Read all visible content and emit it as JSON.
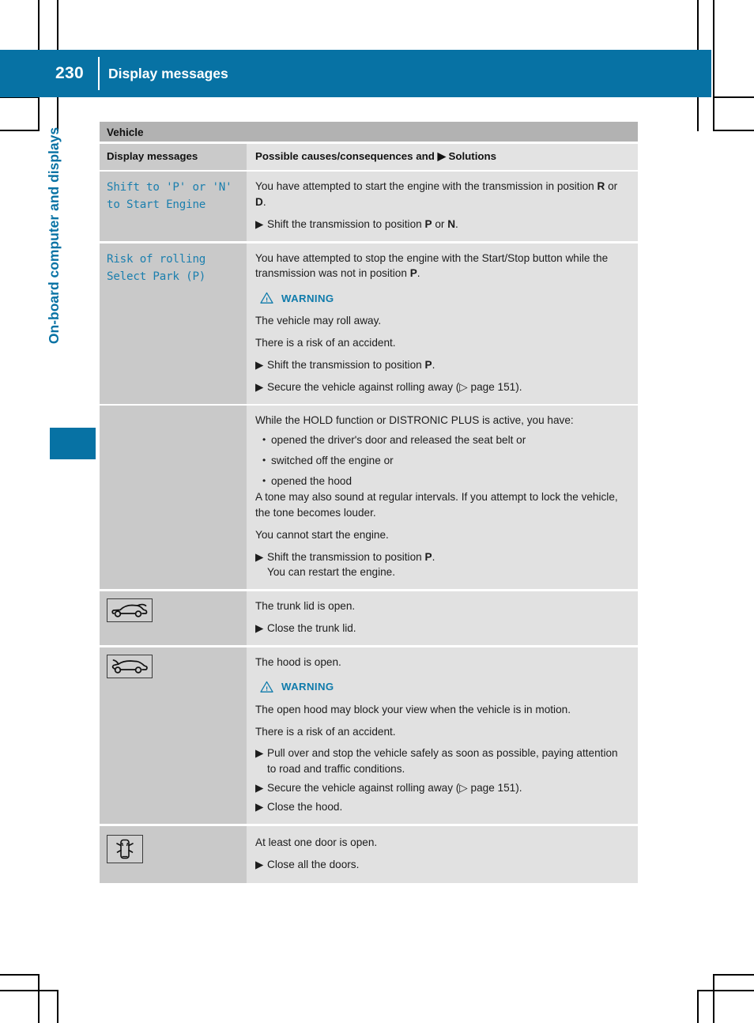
{
  "header": {
    "page_number": "230",
    "title": "Display messages"
  },
  "sidebar": {
    "chapter_label": "On-board computer and displays"
  },
  "table": {
    "section_title": "Vehicle",
    "columns": {
      "left": "Display messages",
      "right": "Possible causes/consequences and ▶ Solutions"
    },
    "rows": [
      {
        "message": "Shift to 'P' or 'N'\nto Start Engine",
        "paragraphs": [
          "You have attempted to start the engine with the transmission in position R or D."
        ],
        "solutions": [
          "Shift the transmission to position P or N."
        ]
      },
      {
        "message": "Risk of rolling\nSelect Park (P)",
        "paragraphs": [
          "You have attempted to stop the engine with the Start/Stop button while the transmission was not in position P."
        ],
        "warning": {
          "label": "WARNING",
          "lines": [
            "The vehicle may roll away.",
            "There is a risk of an accident."
          ]
        },
        "solutions": [
          "Shift the transmission to position P.",
          "Secure the vehicle against rolling away (▷ page 151)."
        ]
      },
      {
        "message": "",
        "paragraphs": [
          "While the HOLD function or DISTRONIC PLUS is active, you have:"
        ],
        "bullets": [
          "opened the driver's door and released the seat belt or",
          "switched off the engine or",
          "opened the hood"
        ],
        "paragraphs2": [
          "A tone may also sound at regular intervals. If you attempt to lock the vehicle, the tone becomes louder.",
          "You cannot start the engine."
        ],
        "solutions": [
          "Shift the transmission to position P."
        ],
        "solution_subline": "You can restart the engine."
      },
      {
        "icon": "car-trunk-open-icon",
        "paragraphs": [
          "The trunk lid is open."
        ],
        "solutions": [
          "Close the trunk lid."
        ]
      },
      {
        "icon": "car-hood-open-icon",
        "paragraphs": [
          "The hood is open."
        ],
        "warning": {
          "label": "WARNING",
          "lines": [
            "The open hood may block your view when the vehicle is in motion.",
            "There is a risk of an accident."
          ]
        },
        "solutions": [
          "Pull over and stop the vehicle safely as soon as possible, paying attention to road and traffic conditions.",
          "Secure the vehicle against rolling away (▷ page 151).",
          "Close the hood."
        ]
      },
      {
        "icon": "car-doors-open-icon",
        "paragraphs": [
          "At least one door is open."
        ],
        "solutions": [
          "Close all the doors."
        ]
      }
    ]
  },
  "colors": {
    "brand_blue": "#0772a4",
    "message_blue": "#1b7fae",
    "warning_blue": "#0f7bab",
    "section_gray": "#b2b2b2",
    "left_cell_gray": "#c9c9c9",
    "right_cell_gray": "#e1e1e1"
  }
}
